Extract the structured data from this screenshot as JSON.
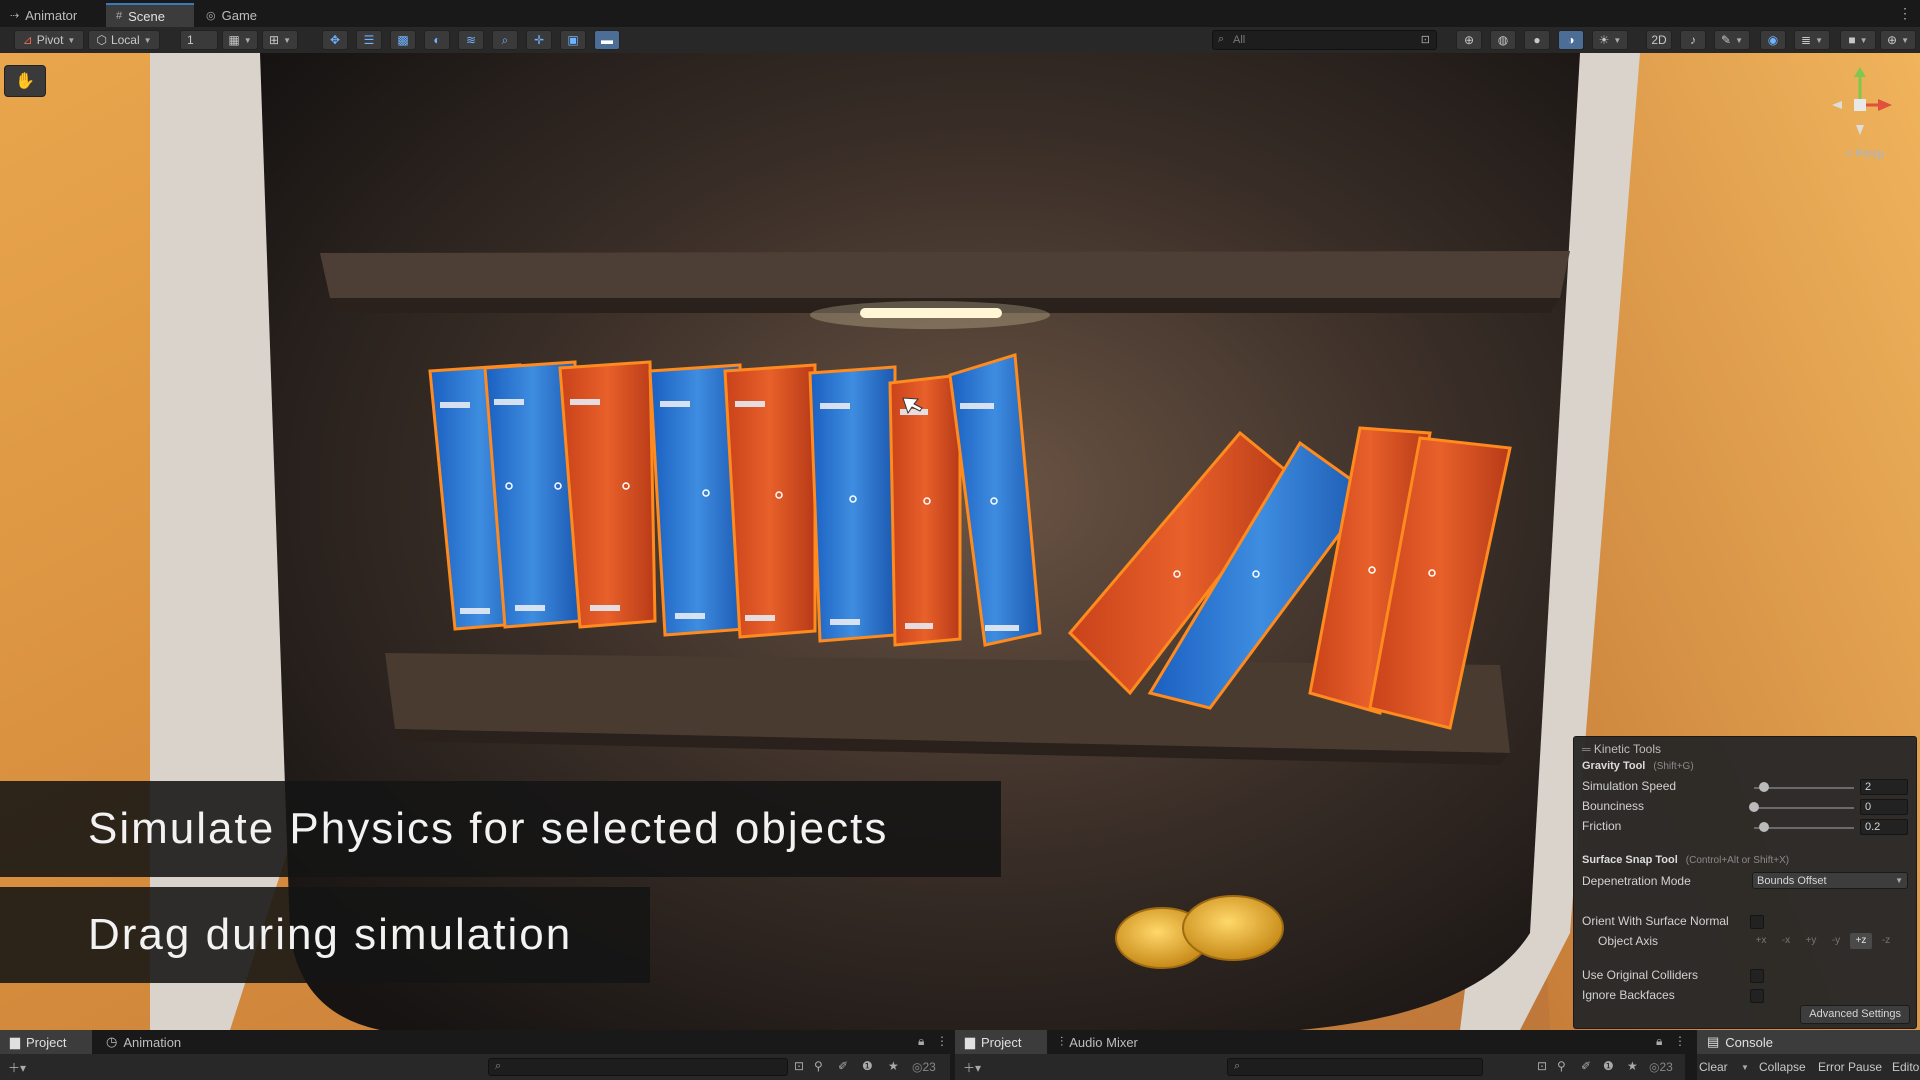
{
  "tabs": [
    {
      "label": "Animator",
      "icon": "⇢"
    },
    {
      "label": "Scene",
      "icon": "#"
    },
    {
      "label": "Game",
      "icon": "◎"
    }
  ],
  "toolbar": {
    "pivot_label": "Pivot",
    "local_label": "Local",
    "grid_value": "1",
    "search_placeholder": "All"
  },
  "scene": {
    "gizmo_label": "< Persp",
    "captions": {
      "line1": "Simulate Physics for selected objects",
      "line2": "Drag during simulation"
    }
  },
  "kinetic_panel": {
    "title": "Kinetic Tools",
    "gravity_tool": {
      "name": "Gravity Tool",
      "shortcut": "(Shift+G)"
    },
    "simulation_speed": {
      "label": "Simulation Speed",
      "value": "2",
      "fraction": 0.1
    },
    "bounciness": {
      "label": "Bounciness",
      "value": "0",
      "fraction": 0.0
    },
    "friction": {
      "label": "Friction",
      "value": "0.2",
      "fraction": 0.1
    },
    "surface_snap": {
      "name": "Surface Snap Tool",
      "shortcut": "(Control+Alt  or  Shift+X)"
    },
    "depenetration": {
      "label": "Depenetration Mode",
      "value": "Bounds Offset"
    },
    "orient_label": "Orient With Surface Normal",
    "object_axis_label": "Object Axis",
    "axes": [
      "+x",
      "-x",
      "+y",
      "-y",
      "+z",
      "-z"
    ],
    "selected_axis": "+z",
    "use_original_colliders": "Use Original Colliders",
    "ignore_backfaces": "Ignore Backfaces",
    "advanced_button": "Advanced Settings"
  },
  "bottom": {
    "left_tabs": [
      {
        "label": "Project",
        "icon": "▆"
      },
      {
        "label": "Animation",
        "icon": "◷"
      }
    ],
    "left_count": "23",
    "right_tabs": [
      {
        "label": "Project",
        "icon": "▆"
      },
      {
        "label": "Audio Mixer",
        "icon": "⫶"
      }
    ],
    "right_count": "23",
    "console_tab": "Console",
    "console_buttons": {
      "clear": "Clear",
      "collapse": "Collapse",
      "error_pause": "Error Pause",
      "editor": "Edito"
    }
  },
  "colors": {
    "accent": "#3a79bb",
    "book_blue": "#1f6fc9",
    "book_orange": "#e1521f",
    "outline": "#ff8a1e"
  }
}
